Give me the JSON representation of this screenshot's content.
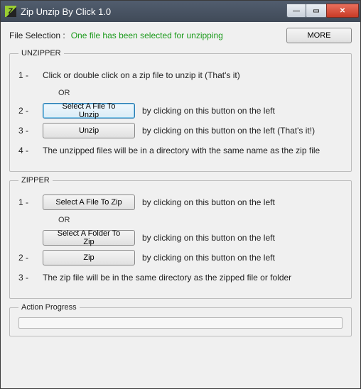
{
  "window": {
    "title": "Zip Unzip By Click 1.0",
    "icon_letter": "Z"
  },
  "titlebar": {
    "min": "—",
    "max": "▭",
    "close": "✕"
  },
  "header": {
    "file_selection_label": "File Selection :",
    "status": "One file has been selected for unzipping",
    "more_button": "MORE"
  },
  "unzipper": {
    "legend": "UNZIPPER",
    "step1": "Click or double click on a zip file to unzip it (That's it)",
    "or": "OR",
    "select_button": "Select A File To Unzip",
    "select_desc": "by clicking on this button on the left",
    "unzip_button": "Unzip",
    "unzip_desc": "by clicking on this button on the left (That's it!)",
    "step4": "The unzipped files will be in a directory with the same name as the zip file",
    "n1": "1 -",
    "n2": "2 -",
    "n3": "3 -",
    "n4": "4 -"
  },
  "zipper": {
    "legend": "ZIPPER",
    "select_file_button": "Select A File To Zip",
    "select_file_desc": "by clicking on this button on the left",
    "or": "OR",
    "select_folder_button": "Select A Folder To Zip",
    "select_folder_desc": "by clicking on this button on the left",
    "zip_button": "Zip",
    "zip_desc": "by clicking on this button on the left",
    "step3": "The zip file will be in the same directory as the zipped file or folder",
    "n1": "1 -",
    "n2": "2 -",
    "n3": "3 -"
  },
  "progress": {
    "legend": "Action Progress",
    "value": 0
  }
}
